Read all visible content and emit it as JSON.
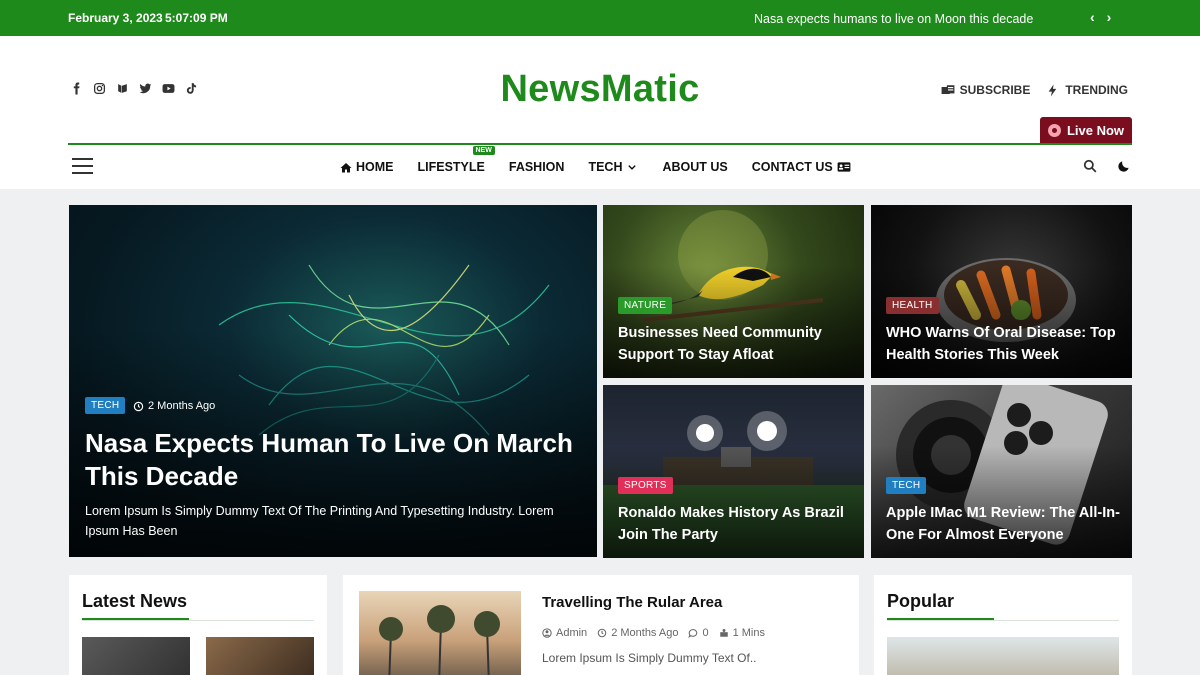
{
  "topbar": {
    "date": "February 3, 2023",
    "time": "5:07:09 PM",
    "ticker": "Nasa expects humans to live on Moon this decade",
    "prev": "‹",
    "next": "›"
  },
  "header": {
    "logo": "NewsMatic",
    "subscribe": "SUBSCRIBE",
    "trending": "TRENDING",
    "live": "Live Now",
    "social": [
      "facebook-icon",
      "instagram-icon",
      "wechat-icon",
      "twitter-icon",
      "youtube-icon",
      "tiktok-icon"
    ]
  },
  "nav": {
    "items": [
      {
        "label": "HOME"
      },
      {
        "label": "LIFESTYLE",
        "badge": "NEW"
      },
      {
        "label": "FASHION"
      },
      {
        "label": "TECH"
      },
      {
        "label": "ABOUT US"
      },
      {
        "label": "CONTACT US"
      }
    ]
  },
  "hero": {
    "main": {
      "category": "TECH",
      "time": "2 Months Ago",
      "title": "Nasa Expects Human To Live On March This Decade",
      "excerpt": "Lorem Ipsum Is Simply Dummy Text Of The Printing And Typesetting Industry. Lorem Ipsum Has Been"
    },
    "cards": [
      {
        "category": "NATURE",
        "title": "Businesses Need Community Support To Stay Afloat"
      },
      {
        "category": "HEALTH",
        "title": "WHO Warns Of Oral Disease: Top Health Stories This Week"
      },
      {
        "category": "SPORTS",
        "title": "Ronaldo Makes History As Brazil Join The Party"
      },
      {
        "category": "TECH",
        "title": "Apple IMac M1 Review: The All-In-One For Almost Everyone"
      }
    ]
  },
  "latest": {
    "heading": "Latest News"
  },
  "feature": {
    "title": "Travelling The Rular Area",
    "author": "Admin",
    "time": "2 Months Ago",
    "comments": "0",
    "read": "1 Mins",
    "excerpt": "Lorem Ipsum Is Simply Dummy Text Of.."
  },
  "popular": {
    "heading": "Popular"
  },
  "colors": {
    "brand": "#1e8a1b",
    "live": "#7a0e1e",
    "cat_tech": "#1f7fc1",
    "cat_nature": "#2a9a2a",
    "cat_health": "#8a2f2f",
    "cat_sports": "#e0305a"
  }
}
